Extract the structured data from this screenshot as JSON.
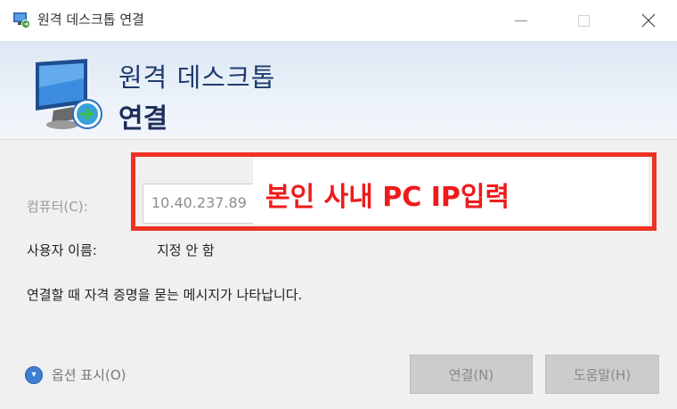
{
  "window": {
    "title": "원격 데스크톱 연결"
  },
  "header": {
    "line1": "원격 데스크톱",
    "line2": "연결"
  },
  "form": {
    "computer_label": "컴퓨터(C):",
    "computer_value": "10.40.237.89",
    "user_label": "사용자 이름:",
    "user_value": "지정 안 함",
    "prompt": "연결할 때 자격 증명을 묻는 메시지가 나타납니다."
  },
  "annotation": {
    "text": "본인 사내 PC IP입력",
    "color": "#ee1b1b",
    "border_color": "#ee3124"
  },
  "footer": {
    "options_label": "옵션 표시(O)",
    "connect_label": "연결(N)",
    "help_label": "도움말(H)"
  },
  "icons": {
    "app": "remote-desktop-icon",
    "options": "chevron-down-circle-icon",
    "minimize": "minimize-icon",
    "maximize": "maximize-icon",
    "close": "close-icon"
  }
}
